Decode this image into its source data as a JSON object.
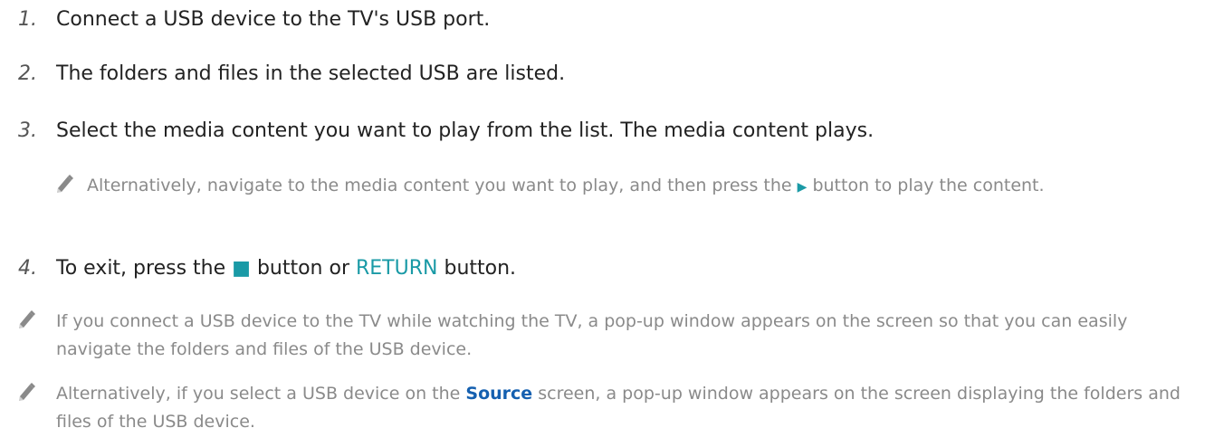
{
  "steps": [
    {
      "num": "1.",
      "text": "Connect a USB device to the TV's USB port."
    },
    {
      "num": "2.",
      "text": "The folders and files in the selected USB are listed."
    },
    {
      "num": "3.",
      "text": "Select the media content you want to play from the list. The media content plays."
    },
    {
      "num": "4.",
      "text_before": "To exit, press the",
      "stop_glyph": "■",
      "text_mid": "button or",
      "return_label": "RETURN",
      "text_after": "button."
    }
  ],
  "step3_note": {
    "text_before": "Alternatively, navigate to the media content you want to play, and then press the",
    "play_glyph": "▶",
    "text_after": "button to play the content."
  },
  "note1": {
    "text": "If you connect a USB device to the TV while watching the TV, a pop-up window appears on the screen so that you can easily navigate the folders and files of the USB device."
  },
  "note2": {
    "text_before": "Alternatively, if you select a USB device on the",
    "source_label": "Source",
    "text_after": "screen, a pop-up window appears on the screen displaying the folders and files of the USB device."
  },
  "colors": {
    "accent_teal": "#1a9aa6",
    "accent_blue": "#1560b0",
    "note_gray": "#8a8a8a"
  },
  "icon": "pencil-note-icon"
}
